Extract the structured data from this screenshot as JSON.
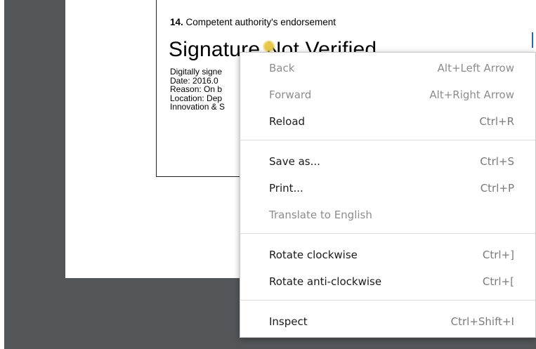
{
  "document": {
    "field_number": "14.",
    "field_title": "Competent authority's endorsement",
    "signature_status": "Signature Not Verified",
    "details": [
      "Digitally signe",
      "Date: 2016.0",
      "Reason: On b",
      "Location: Dep",
      "Innovation & S"
    ]
  },
  "context_menu": {
    "items": [
      {
        "label": "Back",
        "shortcut": "Alt+Left Arrow",
        "enabled": false
      },
      {
        "label": "Forward",
        "shortcut": "Alt+Right Arrow",
        "enabled": false
      },
      {
        "label": "Reload",
        "shortcut": "Ctrl+R",
        "enabled": true
      },
      {
        "label": "Save as...",
        "shortcut": "Ctrl+S",
        "enabled": true
      },
      {
        "label": "Print...",
        "shortcut": "Ctrl+P",
        "enabled": true
      },
      {
        "label": "Translate to English",
        "shortcut": "",
        "enabled": false
      },
      {
        "label": "Rotate clockwise",
        "shortcut": "Ctrl+]",
        "enabled": true
      },
      {
        "label": "Rotate anti-clockwise",
        "shortcut": "Ctrl+[",
        "enabled": true
      },
      {
        "label": "Inspect",
        "shortcut": "Ctrl+Shift+I",
        "enabled": true
      }
    ]
  },
  "colors": {
    "viewer_background": "#525659",
    "page": "#ffffff",
    "disabled_text": "#8c8c8c",
    "caret": "#2f64b4"
  }
}
